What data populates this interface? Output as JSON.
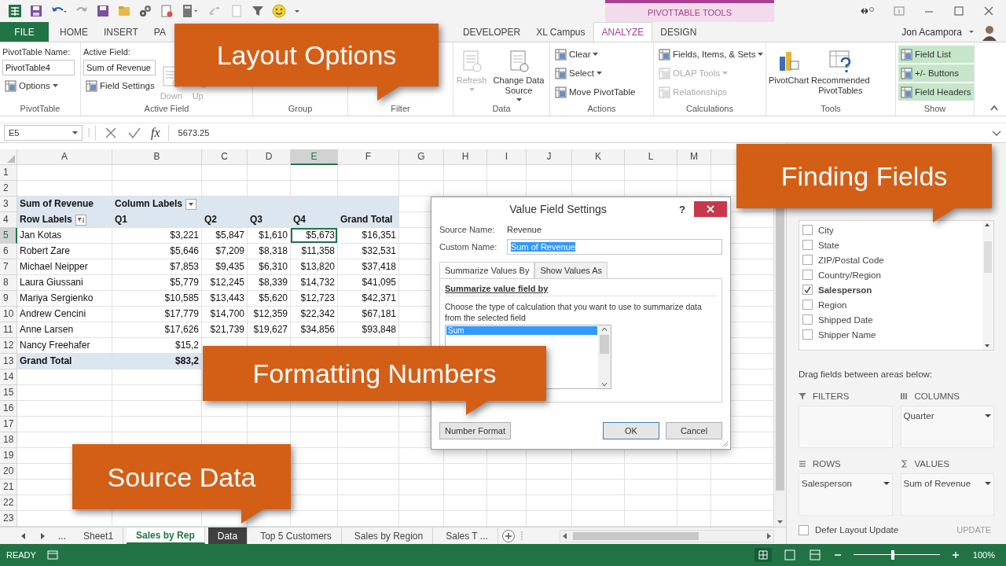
{
  "context_tab_group": "PIVOTTABLE TOOLS",
  "tabs": [
    {
      "label": "FILE",
      "kind": "file",
      "selected": false
    },
    {
      "label": "HOME",
      "kind": "tab",
      "selected": false
    },
    {
      "label": "INSERT",
      "kind": "tab",
      "selected": false
    },
    {
      "label": "PA",
      "kind": "tab",
      "selected": false
    },
    {
      "label": "DEVELOPER",
      "kind": "tab",
      "selected": false
    },
    {
      "label": "XL Campus",
      "kind": "tab",
      "selected": false
    },
    {
      "label": "ANALYZE",
      "kind": "context",
      "selected": true
    },
    {
      "label": "DESIGN",
      "kind": "context",
      "selected": false
    }
  ],
  "user": {
    "name": "Jon Acampora"
  },
  "ribbon_groups": [
    {
      "label": "PivotTable",
      "columns": [
        [
          {
            "kind": "caption",
            "label": "PivotTable Name:"
          },
          {
            "kind": "field",
            "value": "PivotTable4"
          },
          {
            "kind": "small",
            "label": "Options",
            "menu": true,
            "disabled": false
          }
        ]
      ]
    },
    {
      "label": "Active Field",
      "columns": [
        [
          {
            "kind": "caption",
            "label": "Active Field:"
          },
          {
            "kind": "field",
            "value": "Sum of Revenue"
          },
          {
            "kind": "small",
            "label": "Field Settings",
            "menu": false,
            "disabled": false
          }
        ],
        [
          {
            "kind": "large",
            "label": "Down",
            "menu": false,
            "disabled": true
          }
        ],
        [
          {
            "kind": "large",
            "label": "Up",
            "menu": false,
            "disabled": true
          }
        ]
      ]
    },
    {
      "label": "Group"
    },
    {
      "label": "Filter"
    },
    {
      "label": "Data",
      "columns": [
        [
          {
            "kind": "large",
            "label": "Refresh",
            "menu": true,
            "disabled": true
          }
        ],
        [
          {
            "kind": "large",
            "label": "Change Data Source",
            "menu": true,
            "disabled": false
          }
        ]
      ]
    },
    {
      "label": "Actions",
      "columns": [
        [
          {
            "kind": "small",
            "label": "Clear",
            "menu": true,
            "disabled": false
          },
          {
            "kind": "small",
            "label": "Select",
            "menu": true,
            "disabled": false
          },
          {
            "kind": "small",
            "label": "Move PivotTable",
            "menu": false,
            "disabled": false
          }
        ]
      ]
    },
    {
      "label": "Calculations",
      "columns": [
        [
          {
            "kind": "small",
            "label": "Fields, Items, & Sets",
            "menu": true,
            "disabled": false
          },
          {
            "kind": "small",
            "label": "OLAP Tools",
            "menu": true,
            "disabled": true
          },
          {
            "kind": "small",
            "label": "Relationships",
            "menu": false,
            "disabled": true
          }
        ]
      ]
    },
    {
      "label": "Tools",
      "columns": [
        [
          {
            "kind": "large",
            "label": "PivotChart",
            "menu": false,
            "disabled": false
          }
        ],
        [
          {
            "kind": "large",
            "label": "Recommended PivotTables",
            "menu": false,
            "disabled": false
          }
        ]
      ]
    },
    {
      "label": "Show",
      "columns": [
        [
          {
            "kind": "small",
            "label": "Field List",
            "menu": false,
            "disabled": false,
            "selected": true
          },
          {
            "kind": "small",
            "label": "+/- Buttons",
            "menu": false,
            "disabled": false,
            "selected": true
          },
          {
            "kind": "small",
            "label": "Field Headers",
            "menu": false,
            "disabled": false,
            "selected": true
          }
        ]
      ]
    }
  ],
  "formula_bar": {
    "name_box": "E5",
    "function_label": "fx",
    "formula": "5673.25"
  },
  "sheet": {
    "columns": [
      {
        "label": "A",
        "selected": false
      },
      {
        "label": "B",
        "selected": false
      },
      {
        "label": "C",
        "selected": false
      },
      {
        "label": "D",
        "selected": false
      },
      {
        "label": "E",
        "selected": true
      },
      {
        "label": "F",
        "selected": false
      },
      {
        "label": "G",
        "selected": false
      },
      {
        "label": "H",
        "selected": false
      },
      {
        "label": "I",
        "selected": false
      },
      {
        "label": "J",
        "selected": false
      },
      {
        "label": "K",
        "selected": false
      },
      {
        "label": "L",
        "selected": false
      },
      {
        "label": "M",
        "selected": false
      }
    ],
    "rows": [
      {
        "label": "1",
        "selected": false
      },
      {
        "label": "2",
        "selected": false
      },
      {
        "label": "3",
        "selected": false
      },
      {
        "label": "4",
        "selected": false
      },
      {
        "label": "5",
        "selected": true
      },
      {
        "label": "6",
        "selected": false
      },
      {
        "label": "7",
        "selected": false
      },
      {
        "label": "8",
        "selected": false
      },
      {
        "label": "9",
        "selected": false
      },
      {
        "label": "10",
        "selected": false
      },
      {
        "label": "11",
        "selected": false
      },
      {
        "label": "12",
        "selected": false
      },
      {
        "label": "13",
        "selected": false
      },
      {
        "label": "14",
        "selected": false
      },
      {
        "label": "15",
        "selected": false
      },
      {
        "label": "16",
        "selected": false
      },
      {
        "label": "17",
        "selected": false
      },
      {
        "label": "18",
        "selected": false
      },
      {
        "label": "19",
        "selected": false
      },
      {
        "label": "20",
        "selected": false
      },
      {
        "label": "21",
        "selected": false
      },
      {
        "label": "22",
        "selected": false
      },
      {
        "label": "23",
        "selected": false
      }
    ]
  },
  "pivot": {
    "value_label": "Sum of Revenue",
    "column_labels": "Column Labels",
    "row_labels": "Row Labels",
    "columns": [
      "Q1",
      "Q2",
      "Q3",
      "Q4",
      "Grand Total"
    ],
    "rows": [
      {
        "name": "Jan Kotas",
        "values": [
          "$3,221",
          "$5,847",
          "$1,610",
          "$5,673",
          "$16,351"
        ]
      },
      {
        "name": "Robert Zare",
        "values": [
          "$5,646",
          "$7,209",
          "$8,318",
          "$11,358",
          "$32,531"
        ]
      },
      {
        "name": "Michael Neipper",
        "values": [
          "$7,853",
          "$9,435",
          "$6,310",
          "$13,820",
          "$37,418"
        ]
      },
      {
        "name": "Laura Giussani",
        "values": [
          "$5,779",
          "$12,245",
          "$8,339",
          "$14,732",
          "$41,095"
        ]
      },
      {
        "name": "Mariya Sergienko",
        "values": [
          "$10,585",
          "$13,443",
          "$5,620",
          "$12,723",
          "$42,371"
        ]
      },
      {
        "name": "Andrew Cencini",
        "values": [
          "$17,779",
          "$14,700",
          "$12,359",
          "$22,342",
          "$67,181"
        ]
      },
      {
        "name": "Anne Larsen",
        "values": [
          "$17,626",
          "$21,739",
          "$19,627",
          "$34,856",
          "$93,848"
        ]
      },
      {
        "name": "Nancy Freehafer",
        "values": [
          "$15,2"
        ]
      }
    ],
    "total": {
      "name": "Grand Total",
      "values": [
        "$83,2"
      ]
    }
  },
  "dialog": {
    "title": "Value Field Settings",
    "help": "?",
    "source_name_label": "Source Name:",
    "source_name": "Revenue",
    "custom_name_label": "Custom Name:",
    "custom_name": "Sum of Revenue",
    "tabs": [
      {
        "label": "Summarize Values By",
        "selected": true
      },
      {
        "label": "Show Values As",
        "selected": false
      }
    ],
    "section_title": "Summarize value field by",
    "description": "Choose the type of calculation that you want to use to summarize data from the selected field",
    "functions": [
      {
        "label": "Sum",
        "selected": true
      }
    ],
    "buttons": [
      {
        "label": "Number Format",
        "kind": "secondary"
      },
      {
        "label": "OK",
        "kind": "default"
      },
      {
        "label": "Cancel",
        "kind": "secondary"
      }
    ]
  },
  "field_list": {
    "fields": [
      {
        "label": "City",
        "checked": false
      },
      {
        "label": "State",
        "checked": false
      },
      {
        "label": "ZIP/Postal Code",
        "checked": false
      },
      {
        "label": "Country/Region",
        "checked": false
      },
      {
        "label": "Salesperson",
        "checked": true
      },
      {
        "label": "Region",
        "checked": false
      },
      {
        "label": "Shipped Date",
        "checked": false
      },
      {
        "label": "Shipper Name",
        "checked": false
      }
    ],
    "areas_hint": "Drag fields between areas below:",
    "areas": [
      {
        "kind": "filters",
        "label": "FILTERS"
      },
      {
        "kind": "columns",
        "label": "COLUMNS",
        "items": [
          "Quarter"
        ]
      },
      {
        "kind": "rows",
        "label": "ROWS",
        "items": [
          "Salesperson"
        ]
      },
      {
        "kind": "values",
        "label": "VALUES",
        "items": [
          "Sum of Revenue"
        ]
      }
    ],
    "defer": {
      "label": "Defer Layout Update",
      "checked": false
    },
    "update_button": {
      "label": "UPDATE",
      "disabled": true
    }
  },
  "sheet_tabs": {
    "overflow_label": "...",
    "tabs": [
      {
        "label": "Sheet1",
        "selected": false,
        "highlighted": false
      },
      {
        "label": "Sales by Rep",
        "selected": true,
        "highlighted": false
      },
      {
        "label": "Data",
        "selected": false,
        "highlighted": true
      },
      {
        "label": "Top 5 Customers",
        "selected": false,
        "highlighted": false
      },
      {
        "label": "Sales by Region",
        "selected": false,
        "highlighted": false
      },
      {
        "label": "Sales T ...",
        "selected": false,
        "highlighted": false
      }
    ]
  },
  "status_bar": {
    "status": "READY",
    "zoom": {
      "level": 0.45,
      "reading": "100%"
    }
  },
  "callouts": [
    {
      "text": "Layout Options"
    },
    {
      "text": "Finding Fields"
    },
    {
      "text": "Formatting Numbers"
    },
    {
      "text": "Source Data"
    }
  ]
}
